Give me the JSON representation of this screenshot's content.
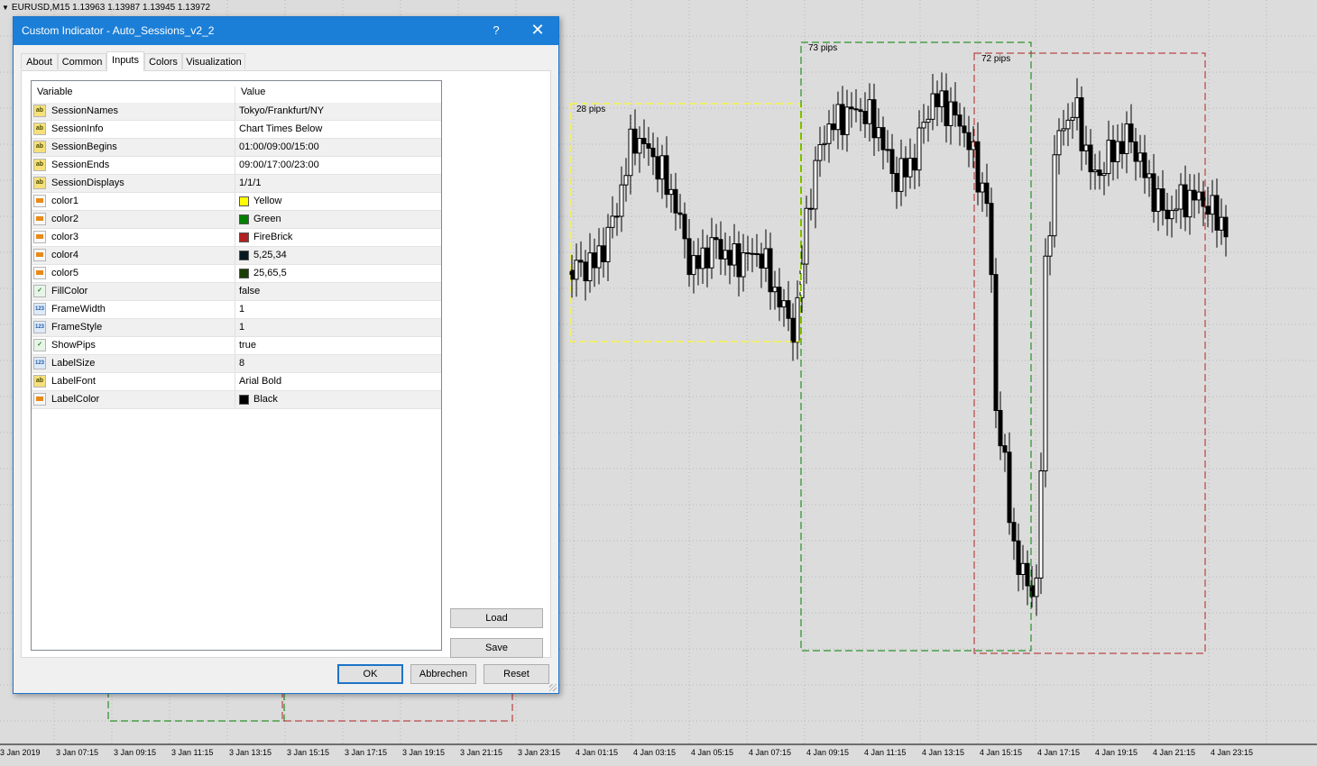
{
  "chart": {
    "symbol_label": "EURUSD,M15  1.13963 1.13987 1.13945 1.13972",
    "session_labels": [
      "28 pips",
      "73 pips",
      "72 pips"
    ],
    "session_colors": {
      "tokyo": "#ffff00",
      "frankfurt": "#008000",
      "ny": "#b22222"
    },
    "time_ticks": [
      "3 Jan 2019",
      "3 Jan 07:15",
      "3 Jan 09:15",
      "3 Jan 11:15",
      "3 Jan 13:15",
      "3 Jan 15:15",
      "3 Jan 17:15",
      "3 Jan 19:15",
      "3 Jan 21:15",
      "3 Jan 23:15",
      "4 Jan 01:15",
      "4 Jan 03:15",
      "4 Jan 05:15",
      "4 Jan 07:15",
      "4 Jan 09:15",
      "4 Jan 11:15",
      "4 Jan 13:15",
      "4 Jan 15:15",
      "4 Jan 17:15",
      "4 Jan 19:15",
      "4 Jan 21:15",
      "4 Jan 23:15"
    ]
  },
  "dialog": {
    "title": "Custom Indicator - Auto_Sessions_v2_2",
    "help_glyph": "?",
    "close_glyph": "✕",
    "tabs": [
      "About",
      "Common",
      "Inputs",
      "Colors",
      "Visualization"
    ],
    "active_tab": "Inputs",
    "columns": {
      "variable": "Variable",
      "value": "Value"
    },
    "rows": [
      {
        "icon": "ab",
        "variable": "SessionNames",
        "value": "Tokyo/Frankfurt/NY"
      },
      {
        "icon": "ab",
        "variable": "SessionInfo",
        "value": "Chart Times Below"
      },
      {
        "icon": "ab",
        "variable": "SessionBegins",
        "value": "01:00/09:00/15:00"
      },
      {
        "icon": "ab",
        "variable": "SessionEnds",
        "value": "09:00/17:00/23:00"
      },
      {
        "icon": "ab",
        "variable": "SessionDisplays",
        "value": "1/1/1"
      },
      {
        "icon": "color",
        "variable": "color1",
        "value": "Yellow",
        "swatch": "#ffff00"
      },
      {
        "icon": "color",
        "variable": "color2",
        "value": "Green",
        "swatch": "#008000"
      },
      {
        "icon": "color",
        "variable": "color3",
        "value": "FireBrick",
        "swatch": "#b22222"
      },
      {
        "icon": "color",
        "variable": "color4",
        "value": "5,25,34",
        "swatch": "#051922"
      },
      {
        "icon": "color",
        "variable": "color5",
        "value": "25,65,5",
        "swatch": "#194105"
      },
      {
        "icon": "bool",
        "variable": "FillColor",
        "value": "false"
      },
      {
        "icon": "num",
        "variable": "FrameWidth",
        "value": "1"
      },
      {
        "icon": "num",
        "variable": "FrameStyle",
        "value": "1"
      },
      {
        "icon": "bool",
        "variable": "ShowPips",
        "value": "true"
      },
      {
        "icon": "num",
        "variable": "LabelSize",
        "value": "8"
      },
      {
        "icon": "ab",
        "variable": "LabelFont",
        "value": "Arial Bold"
      },
      {
        "icon": "color",
        "variable": "LabelColor",
        "value": "Black",
        "swatch": "#000000"
      }
    ],
    "load_label": "Load",
    "save_label": "Save",
    "ok_label": "OK",
    "cancel_label": "Abbrechen",
    "reset_label": "Reset"
  }
}
